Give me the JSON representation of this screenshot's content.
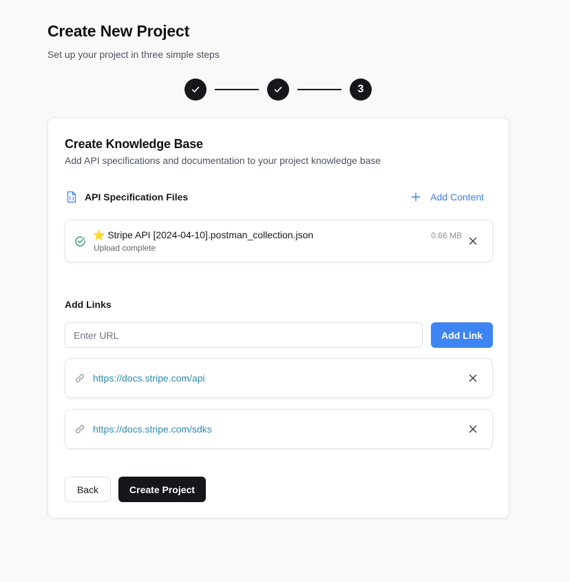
{
  "header": {
    "title": "Create New Project",
    "subtitle": "Set up your project in three simple steps"
  },
  "stepper": {
    "steps": [
      {
        "state": "complete",
        "icon": "check-icon"
      },
      {
        "state": "complete",
        "icon": "check-icon"
      },
      {
        "state": "current",
        "label": "3"
      }
    ]
  },
  "card": {
    "title": "Create Knowledge Base",
    "description": "Add API specifications and documentation to your project knowledge base",
    "files": {
      "title": "API Specification Files",
      "add_content_label": "Add Content",
      "items": [
        {
          "name": "⭐ Stripe API [2024-04-10].postman_collection.json",
          "status": "Upload complete",
          "size": "0.66 MB"
        }
      ]
    },
    "links": {
      "title": "Add Links",
      "input_placeholder": "Enter URL",
      "input_value": "",
      "add_button_label": "Add Link",
      "items": [
        {
          "url": "https://docs.stripe.com/api"
        },
        {
          "url": "https://docs.stripe.com/sdks"
        }
      ]
    },
    "actions": {
      "back_label": "Back",
      "create_label": "Create Project"
    }
  },
  "colors": {
    "accent_blue": "#3d85f2",
    "link_text": "#2b8ab3",
    "success_green": "#2fa36b",
    "dark": "#16171b"
  }
}
